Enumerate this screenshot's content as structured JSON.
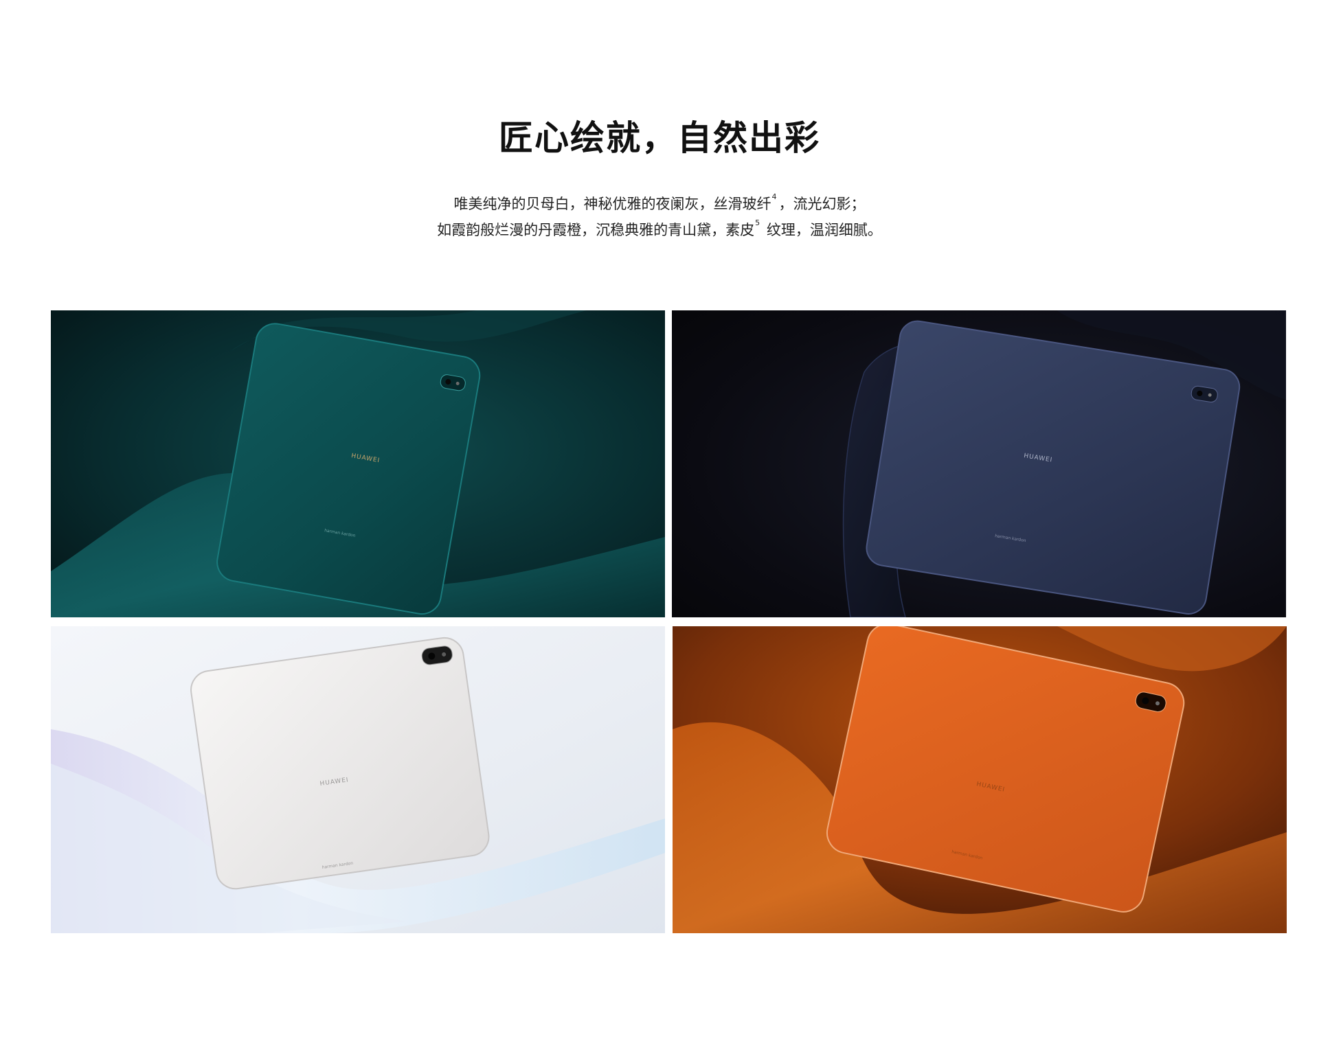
{
  "section": {
    "title": "匠心绘就，自然出彩",
    "description_line1_a": "唯美纯净的贝母白，神秘优雅的夜阑灰，丝滑玻纤",
    "description_line1_sup": "4",
    "description_line1_b": "，流光幻影；",
    "description_line2_a": "如霞韵般烂漫的丹霞橙，沉稳典雅的青山黛，素皮",
    "description_line2_sup": "5",
    "description_line2_b": " 纹理，温润细腻。"
  },
  "gallery": [
    {
      "colorway": "青山黛",
      "brand_text": "HUAWEI",
      "sub_brand_text": "harman kardon",
      "background_color": "#0a3a3c",
      "device_color": "#0e5457"
    },
    {
      "colorway": "夜阑灰",
      "brand_text": "HUAWEI",
      "sub_brand_text": "harman kardon",
      "background_color": "#0c0c14",
      "device_color": "#2f3a58"
    },
    {
      "colorway": "贝母白",
      "brand_text": "HUAWEI",
      "sub_brand_text": "harman kardon",
      "background_color": "#eef1f5",
      "device_color": "#ecebeb"
    },
    {
      "colorway": "丹霞橙",
      "brand_text": "HUAWEI",
      "sub_brand_text": "harman kardon",
      "background_color": "#8a3a0c",
      "device_color": "#e0621e"
    }
  ]
}
